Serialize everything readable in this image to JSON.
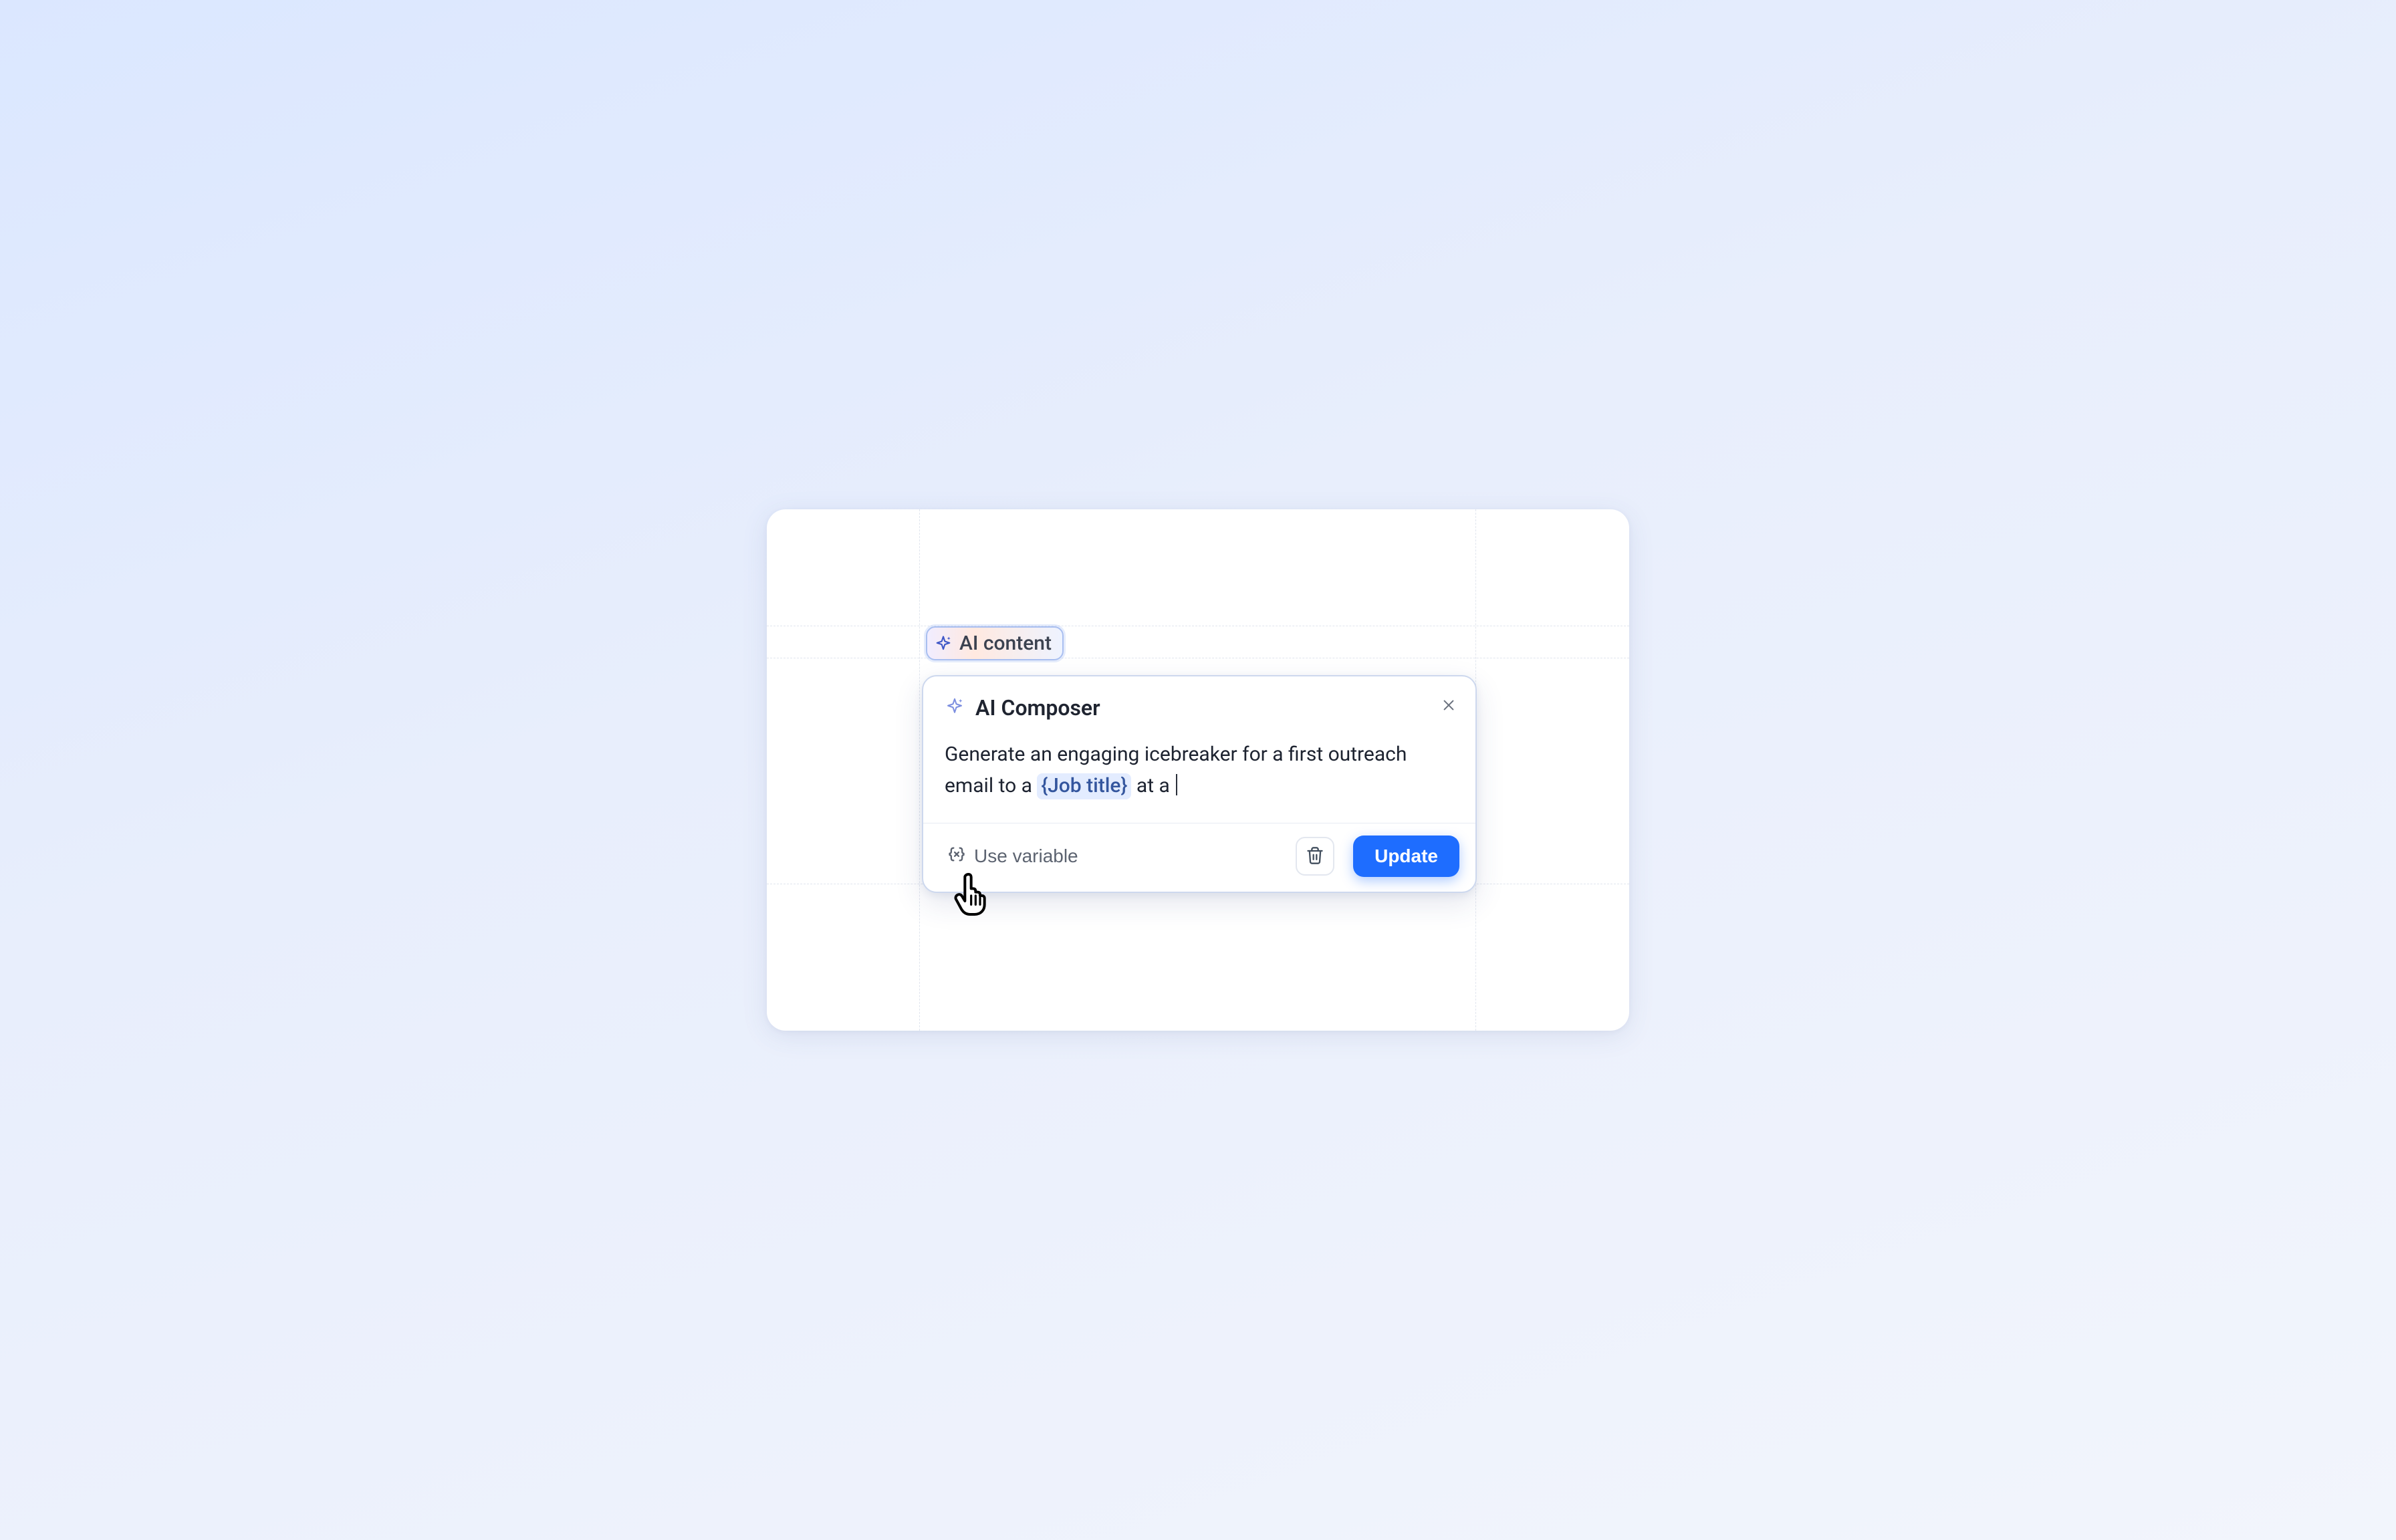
{
  "tag": {
    "label": "AI content"
  },
  "composer": {
    "title": "AI Composer",
    "prompt_prefix": "Generate an engaging icebreaker for a first outreach email to a ",
    "variable_chip": "{Job title}",
    "prompt_suffix": " at a ",
    "use_variable_label": "Use variable",
    "update_label": "Update"
  },
  "icons": {
    "sparkle": "sparkle",
    "close": "close",
    "variable": "variable-braces",
    "trash": "trash",
    "pointer": "pointer-hand"
  }
}
